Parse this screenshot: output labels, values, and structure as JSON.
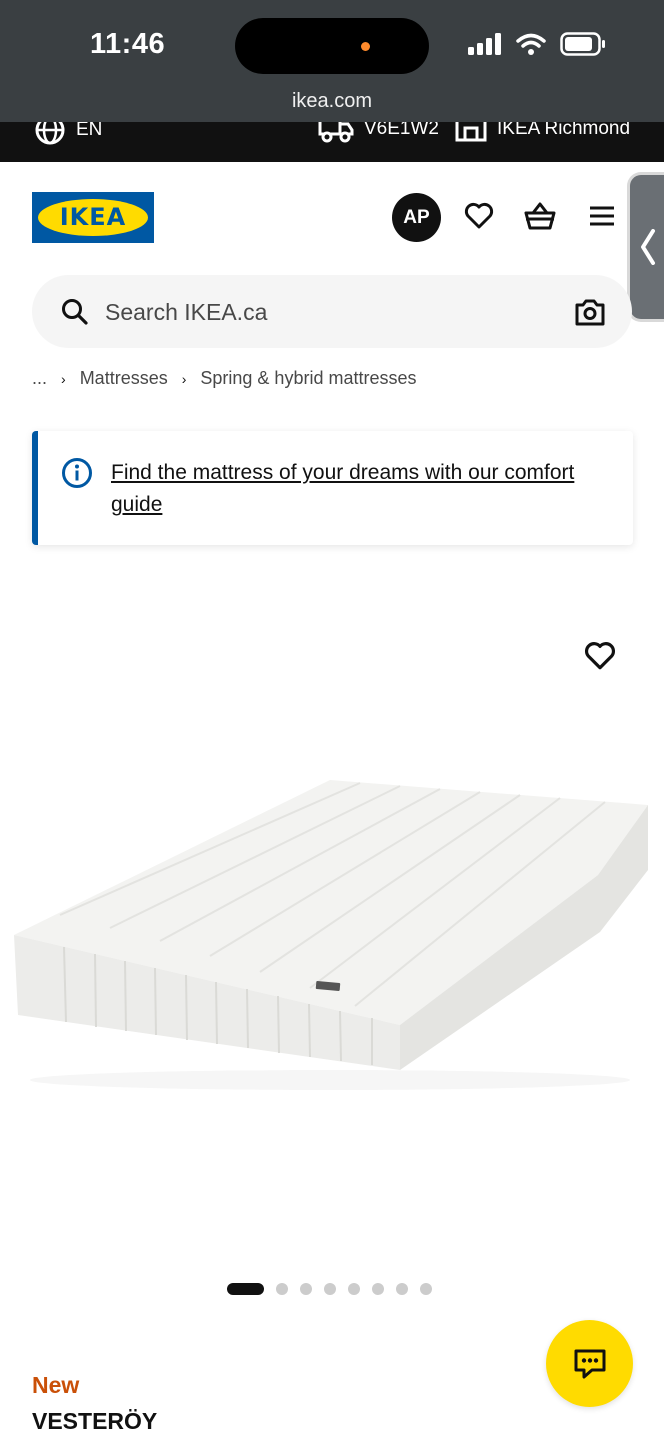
{
  "status_bar": {
    "time": "11:46",
    "url": "ikea.com"
  },
  "utility_bar": {
    "language": "EN",
    "postal_code": "V6E1W2",
    "store": "IKEA Richmond"
  },
  "header": {
    "logo_text": "IKEA",
    "avatar_initials": "AP"
  },
  "search": {
    "placeholder": "Search IKEA.ca"
  },
  "breadcrumb": [
    "...",
    "Mattresses",
    "Spring & hybrid mattresses"
  ],
  "info_banner": {
    "link_text": "Find the mattress of your dreams with our comfort guide"
  },
  "carousel": {
    "total_images": 8,
    "active_index": 0
  },
  "product": {
    "badge": "New",
    "name": "VESTERÖY"
  },
  "colors": {
    "ikea_blue": "#0058a3",
    "ikea_yellow": "#ffdb00",
    "new_badge": "#ca5008"
  },
  "icons": [
    "globe-icon",
    "truck-icon",
    "store-icon",
    "heart-icon",
    "basket-icon",
    "menu-icon",
    "search-icon",
    "camera-icon",
    "info-icon",
    "chat-icon",
    "chevron-left-icon"
  ]
}
